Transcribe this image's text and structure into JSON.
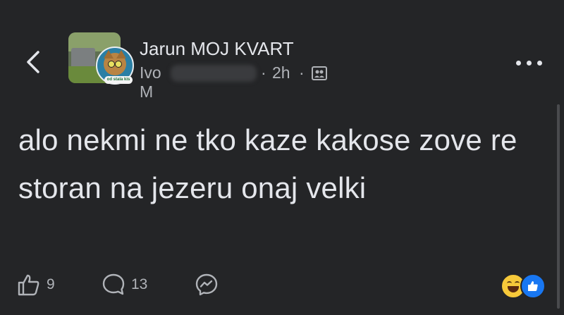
{
  "header": {
    "group_name": "Jarun MOJ KVART",
    "author": "Ivo M",
    "separator": "·",
    "time": "2h",
    "avatar_sticker": "od stala kis"
  },
  "post": {
    "text": "alo nekmi ne tko kaze kakose zove re storan na jezeru onaj velki"
  },
  "actions": {
    "like_count": "9",
    "comment_count": "13"
  },
  "icons": {
    "back": "chevron-left-icon",
    "more": "ellipsis-icon",
    "privacy": "group-members-icon",
    "like": "thumbs-up-icon",
    "comment": "comment-bubble-icon",
    "share": "messenger-icon",
    "reaction_laugh": "haha-reaction-icon",
    "reaction_like": "like-reaction-icon"
  },
  "colors": {
    "background": "#242527",
    "text_primary": "#e4e6eb",
    "text_secondary": "#b0b3b8",
    "like_blue": "#1877f2",
    "laugh_yellow": "#f7c93a"
  }
}
